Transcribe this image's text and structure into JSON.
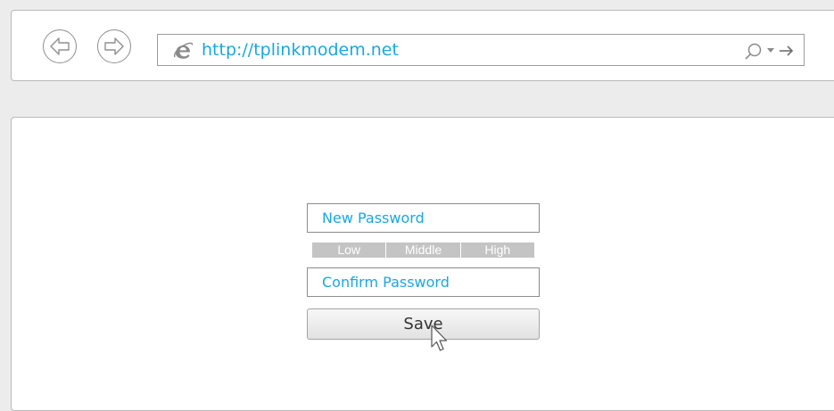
{
  "browser": {
    "url": "http://tplinkmodem.net",
    "icons": {
      "back": "back-arrow-icon",
      "forward": "forward-arrow-icon",
      "page": "ie-icon",
      "search": "search-icon",
      "dropdown": "chevron-down-icon",
      "go": "go-arrow-icon"
    }
  },
  "form": {
    "new_password_placeholder": "New Password",
    "strength": {
      "low": "Low",
      "middle": "Middle",
      "high": "High"
    },
    "confirm_password_placeholder": "Confirm Password",
    "save_label": "Save"
  },
  "colors": {
    "accent": "#1aa7e0",
    "strength_bar": "#c4c4c4",
    "border": "#8c8c8c"
  }
}
